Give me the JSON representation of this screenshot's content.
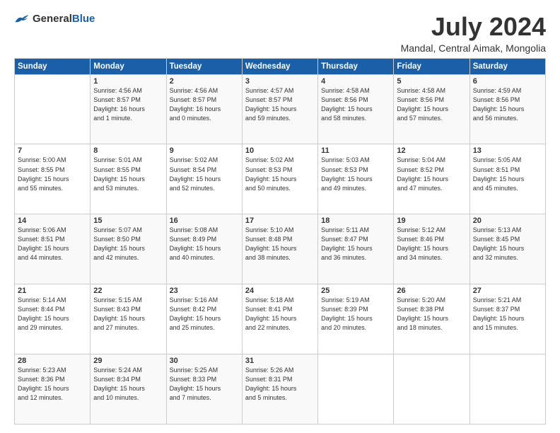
{
  "header": {
    "logo_general": "General",
    "logo_blue": "Blue",
    "title": "July 2024",
    "location": "Mandal, Central Aimak, Mongolia"
  },
  "days_of_week": [
    "Sunday",
    "Monday",
    "Tuesday",
    "Wednesday",
    "Thursday",
    "Friday",
    "Saturday"
  ],
  "weeks": [
    [
      {
        "day": "",
        "info": ""
      },
      {
        "day": "1",
        "info": "Sunrise: 4:56 AM\nSunset: 8:57 PM\nDaylight: 16 hours\nand 1 minute."
      },
      {
        "day": "2",
        "info": "Sunrise: 4:56 AM\nSunset: 8:57 PM\nDaylight: 16 hours\nand 0 minutes."
      },
      {
        "day": "3",
        "info": "Sunrise: 4:57 AM\nSunset: 8:57 PM\nDaylight: 15 hours\nand 59 minutes."
      },
      {
        "day": "4",
        "info": "Sunrise: 4:58 AM\nSunset: 8:56 PM\nDaylight: 15 hours\nand 58 minutes."
      },
      {
        "day": "5",
        "info": "Sunrise: 4:58 AM\nSunset: 8:56 PM\nDaylight: 15 hours\nand 57 minutes."
      },
      {
        "day": "6",
        "info": "Sunrise: 4:59 AM\nSunset: 8:56 PM\nDaylight: 15 hours\nand 56 minutes."
      }
    ],
    [
      {
        "day": "7",
        "info": "Sunrise: 5:00 AM\nSunset: 8:55 PM\nDaylight: 15 hours\nand 55 minutes."
      },
      {
        "day": "8",
        "info": "Sunrise: 5:01 AM\nSunset: 8:55 PM\nDaylight: 15 hours\nand 53 minutes."
      },
      {
        "day": "9",
        "info": "Sunrise: 5:02 AM\nSunset: 8:54 PM\nDaylight: 15 hours\nand 52 minutes."
      },
      {
        "day": "10",
        "info": "Sunrise: 5:02 AM\nSunset: 8:53 PM\nDaylight: 15 hours\nand 50 minutes."
      },
      {
        "day": "11",
        "info": "Sunrise: 5:03 AM\nSunset: 8:53 PM\nDaylight: 15 hours\nand 49 minutes."
      },
      {
        "day": "12",
        "info": "Sunrise: 5:04 AM\nSunset: 8:52 PM\nDaylight: 15 hours\nand 47 minutes."
      },
      {
        "day": "13",
        "info": "Sunrise: 5:05 AM\nSunset: 8:51 PM\nDaylight: 15 hours\nand 45 minutes."
      }
    ],
    [
      {
        "day": "14",
        "info": "Sunrise: 5:06 AM\nSunset: 8:51 PM\nDaylight: 15 hours\nand 44 minutes."
      },
      {
        "day": "15",
        "info": "Sunrise: 5:07 AM\nSunset: 8:50 PM\nDaylight: 15 hours\nand 42 minutes."
      },
      {
        "day": "16",
        "info": "Sunrise: 5:08 AM\nSunset: 8:49 PM\nDaylight: 15 hours\nand 40 minutes."
      },
      {
        "day": "17",
        "info": "Sunrise: 5:10 AM\nSunset: 8:48 PM\nDaylight: 15 hours\nand 38 minutes."
      },
      {
        "day": "18",
        "info": "Sunrise: 5:11 AM\nSunset: 8:47 PM\nDaylight: 15 hours\nand 36 minutes."
      },
      {
        "day": "19",
        "info": "Sunrise: 5:12 AM\nSunset: 8:46 PM\nDaylight: 15 hours\nand 34 minutes."
      },
      {
        "day": "20",
        "info": "Sunrise: 5:13 AM\nSunset: 8:45 PM\nDaylight: 15 hours\nand 32 minutes."
      }
    ],
    [
      {
        "day": "21",
        "info": "Sunrise: 5:14 AM\nSunset: 8:44 PM\nDaylight: 15 hours\nand 29 minutes."
      },
      {
        "day": "22",
        "info": "Sunrise: 5:15 AM\nSunset: 8:43 PM\nDaylight: 15 hours\nand 27 minutes."
      },
      {
        "day": "23",
        "info": "Sunrise: 5:16 AM\nSunset: 8:42 PM\nDaylight: 15 hours\nand 25 minutes."
      },
      {
        "day": "24",
        "info": "Sunrise: 5:18 AM\nSunset: 8:41 PM\nDaylight: 15 hours\nand 22 minutes."
      },
      {
        "day": "25",
        "info": "Sunrise: 5:19 AM\nSunset: 8:39 PM\nDaylight: 15 hours\nand 20 minutes."
      },
      {
        "day": "26",
        "info": "Sunrise: 5:20 AM\nSunset: 8:38 PM\nDaylight: 15 hours\nand 18 minutes."
      },
      {
        "day": "27",
        "info": "Sunrise: 5:21 AM\nSunset: 8:37 PM\nDaylight: 15 hours\nand 15 minutes."
      }
    ],
    [
      {
        "day": "28",
        "info": "Sunrise: 5:23 AM\nSunset: 8:36 PM\nDaylight: 15 hours\nand 12 minutes."
      },
      {
        "day": "29",
        "info": "Sunrise: 5:24 AM\nSunset: 8:34 PM\nDaylight: 15 hours\nand 10 minutes."
      },
      {
        "day": "30",
        "info": "Sunrise: 5:25 AM\nSunset: 8:33 PM\nDaylight: 15 hours\nand 7 minutes."
      },
      {
        "day": "31",
        "info": "Sunrise: 5:26 AM\nSunset: 8:31 PM\nDaylight: 15 hours\nand 5 minutes."
      },
      {
        "day": "",
        "info": ""
      },
      {
        "day": "",
        "info": ""
      },
      {
        "day": "",
        "info": ""
      }
    ]
  ]
}
